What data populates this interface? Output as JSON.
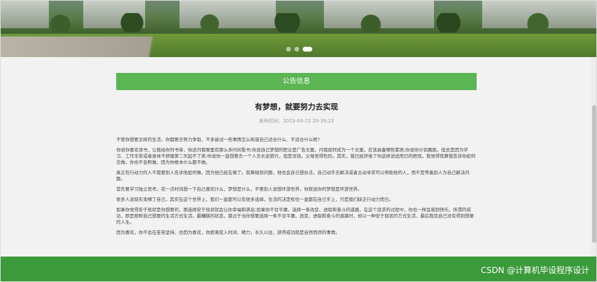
{
  "banner": {
    "carousel_dots": [
      false,
      false,
      true
    ]
  },
  "notice": {
    "heading": "公告信息"
  },
  "article": {
    "title": "有梦想，就要努力去实现",
    "meta_label": "发布时间：",
    "meta_time": "2023-04-23 20:39:23",
    "paragraphs": [
      "不管你想要怎样的生活，你都要去努力争取，不多尝试一些事情怎么知道自己适合什么、不适合什么呢?",
      "你说你喜欢读书，让我给你列书单，你还问我哪里有那么多时间看书;你说自己梦想的职业是广告文案，问我如何成为一个文案，应该具备哪些素质;你说你计划晨跑，但总是因为学习、工作辛苦或者身体不舒服第二天起不了床;你说你一直想要去一个人去长途旅行，但是没钱，父母觉得危险。其实，我已经厌倦了你这样说说而已的把戏，我觉得就算我告诉你如何去做，你也不会照做，因为你根本什么都不做。",
      "真正有行动力的人不需要别人告诉他如何做，因为他已经在做了。就算碰到问题，他也会自己想办法，自己动手去解决或者主动寻求可以帮助他的人，而不是等着别人为自己解决问题。",
      "首先要学习独立思考。花一点时间想一下自己喜欢什么，梦想是什么，不要别人说想环游世界，你就说你的梦想是环游世界。",
      "很多人说现实束缚了自己，其实在这个世界上，我们一直都可以有很多选择，生活的决定权也一直都在自己手上，只是我们缺乏行动力而已。",
      "如果你觉得安于现状是你想要的，那选择安于现状就会让你幸福和满足;如果你不甘平庸，选择一条改变、进取和奋斗的道路，在这个追求的过程中，你也一样会感到快乐。所谓的成功，即是按照自己想要的生活方式生活。最糟糕的状态，莫过于当你想要选择一条不甘平庸、改变、进取和奋斗的道路时，却以一种安于现状的方式生活，最后抱怨自己没有得到想要的人生。",
      "因为喜欢，你不会在苦苦坚持，也因为喜欢，你愿意投入时间、精力，长久以往，获得成功就是自然而然的事情。"
    ]
  },
  "watermark": {
    "text": "CSDN @计算机毕设程序设计"
  }
}
